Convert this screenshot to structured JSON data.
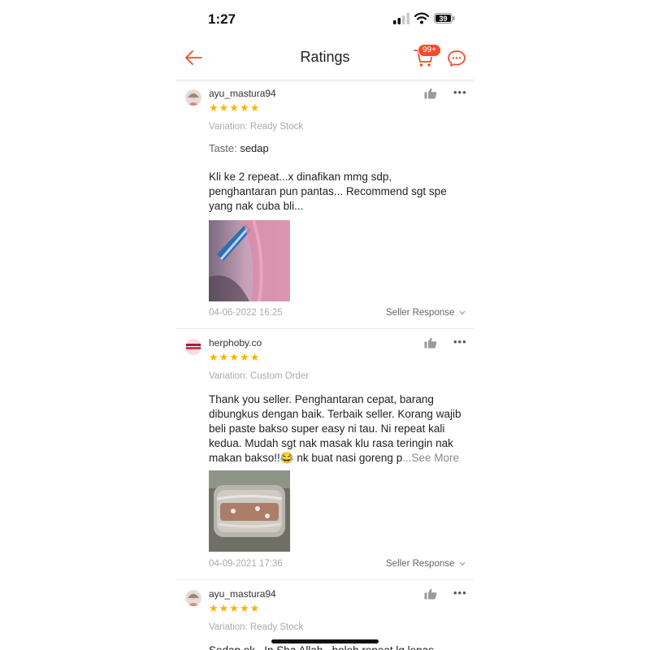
{
  "status_bar": {
    "time": "1:27",
    "battery": "39"
  },
  "nav": {
    "title": "Ratings",
    "cart_badge": "99+"
  },
  "reviews": [
    {
      "username": "ayu_mastura94",
      "stars": "★★★★★",
      "variation": "Variation: Ready Stock",
      "taste_label": "Taste:",
      "taste_value": "sedap",
      "comment_lines": [
        "Kli ke 2 repeat...x dinafikan mmg sdp,",
        "penghantaran pun pantas... Recommend sgt spe",
        "yang nak cuba bli..."
      ],
      "date": "04-06-2022 16:25",
      "seller_response": "Seller Response"
    },
    {
      "username": "herphoby.co",
      "stars": "★★★★★",
      "variation": "Variation: Custom Order",
      "comment_lines": [
        "Thank you seller. Penghantaran cepat, barang",
        "dibungkus dengan baik. Terbaik seller. Korang wajib",
        "beli paste bakso super easy ni tau. Ni repeat kali",
        "kedua. Mudah sgt nak masak klu rasa teringin nak"
      ],
      "last_line": "makan bakso!!😂 nk buat nasi goreng p",
      "see_more": "...See More",
      "date": "04-09-2021 17:36",
      "seller_response": "Seller Response"
    },
    {
      "username": "ayu_mastura94",
      "stars": "★★★★★",
      "variation": "Variation: Ready Stock",
      "comment_partial": "Sedap ok...In Sha Allah...boleh repeat lg lepas"
    }
  ],
  "colors": {
    "accent": "#ee4d2d",
    "star": "#f5b400"
  },
  "icons": [
    "back-arrow-icon",
    "cart-icon",
    "chat-icon",
    "thumbs-up-icon",
    "more-icon",
    "chevron-down-icon"
  ]
}
